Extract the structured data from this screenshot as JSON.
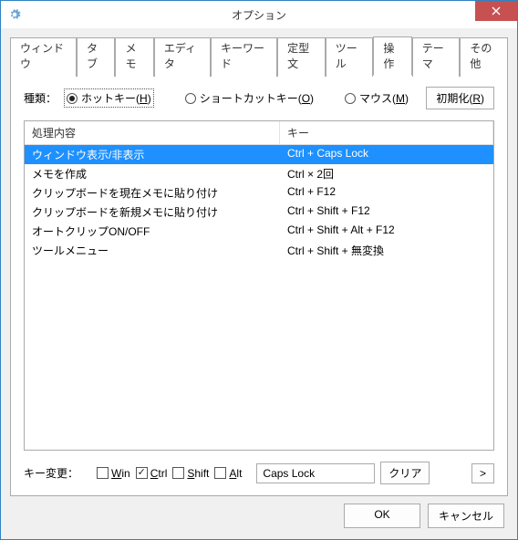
{
  "window": {
    "title": "オプション"
  },
  "tabs": {
    "items": [
      {
        "label": "ウィンドウ"
      },
      {
        "label": "タブ"
      },
      {
        "label": "メモ"
      },
      {
        "label": "エディタ"
      },
      {
        "label": "キーワード"
      },
      {
        "label": "定型文"
      },
      {
        "label": "ツール"
      },
      {
        "label": "操作"
      },
      {
        "label": "テーマ"
      },
      {
        "label": "その他"
      }
    ],
    "active_index": 7
  },
  "type_label": "種類：",
  "radios": {
    "hotkey": {
      "label": "ホットキー(",
      "mnemonic": "H",
      "suffix": ")"
    },
    "shortcut": {
      "label": "ショートカットキー(",
      "mnemonic": "O",
      "suffix": ")"
    },
    "mouse": {
      "label": "マウス(",
      "mnemonic": "M",
      "suffix": ")"
    },
    "selected": "hotkey"
  },
  "reset_button": {
    "label": "初期化(",
    "mnemonic": "R",
    "suffix": ")"
  },
  "table": {
    "headers": {
      "action": "処理内容",
      "key": "キー"
    },
    "rows": [
      {
        "action": "ウィンドウ表示/非表示",
        "key": "Ctrl + Caps Lock",
        "selected": true
      },
      {
        "action": "メモを作成",
        "key": "Ctrl × 2回"
      },
      {
        "action": "クリップボードを現在メモに貼り付け",
        "key": "Ctrl + F12"
      },
      {
        "action": "クリップボードを新規メモに貼り付け",
        "key": "Ctrl + Shift + F12"
      },
      {
        "action": "オートクリップON/OFF",
        "key": "Ctrl + Shift + Alt + F12"
      },
      {
        "action": "ツールメニュー",
        "key": "Ctrl + Shift + 無変換"
      }
    ]
  },
  "keychange": {
    "label": "キー変更：",
    "mods": {
      "win": {
        "mnemonic": "W",
        "rest": "in",
        "checked": false
      },
      "ctrl": {
        "mnemonic": "C",
        "rest": "trl",
        "checked": true
      },
      "shift": {
        "mnemonic": "S",
        "rest": "hift",
        "checked": false
      },
      "alt": {
        "mnemonic": "A",
        "rest": "lt",
        "checked": false
      }
    },
    "keyfield": "Caps Lock",
    "clear_label": "クリア",
    "more_label": ">"
  },
  "footer": {
    "ok": "OK",
    "cancel": "キャンセル"
  }
}
